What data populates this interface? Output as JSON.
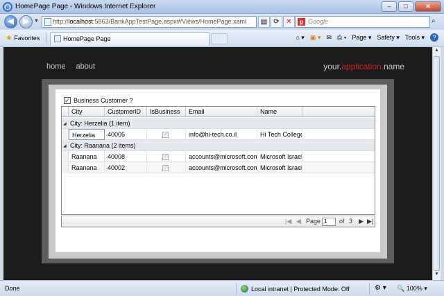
{
  "window": {
    "title": "HomePage Page - Windows Internet Explorer",
    "buttons": [
      "–",
      "□",
      "✕"
    ]
  },
  "address": {
    "url_prefix": "http://",
    "url_host": "localhost",
    "url_rest": ":5863/BankAppTestPage.aspx#/Views/HomePage.xaml"
  },
  "search": {
    "placeholder": "Google"
  },
  "favorites": {
    "label": "Favorites"
  },
  "tab": {
    "label": "HomePage Page"
  },
  "command_bar": {
    "page": "Page ▾",
    "safety": "Safety ▾",
    "tools": "Tools ▾",
    "help": "?"
  },
  "site": {
    "nav": [
      "home",
      "about"
    ],
    "brand_your": "your.",
    "brand_application": "application.",
    "brand_name": "name"
  },
  "form": {
    "checkbox_label": "Business Customer ?",
    "checked": true
  },
  "grid": {
    "columns": [
      "City",
      "CustomerID",
      "IsBusiness",
      "Email",
      "Name"
    ],
    "sorted_column": "CustomerID",
    "groups": [
      {
        "label": "City: Herzelia (1 item)",
        "rows": [
          {
            "city": "Herzelia",
            "id": "40005",
            "email": "info@hi-tech.co.il",
            "name": "Hi Tech College"
          }
        ]
      },
      {
        "label": "City: Raanana (2 items)",
        "rows": [
          {
            "city": "Raanana",
            "id": "40008",
            "email": "accounts@microsoft.com",
            "name": "Microsoft Israel"
          },
          {
            "city": "Raanana",
            "id": "40002",
            "email": "accounts@microsoft.com",
            "name": "Microsoft Israel"
          }
        ]
      }
    ]
  },
  "pager": {
    "page_label": "Page",
    "page_value": "1",
    "of_label": "of",
    "total": "3"
  },
  "status": {
    "text": "Done",
    "zone": "Local intranet | Protected Mode: Off",
    "zoom": "100%"
  },
  "colors": {
    "brand_accent": "#cc2222",
    "site_bg": "#1c1c1c"
  }
}
